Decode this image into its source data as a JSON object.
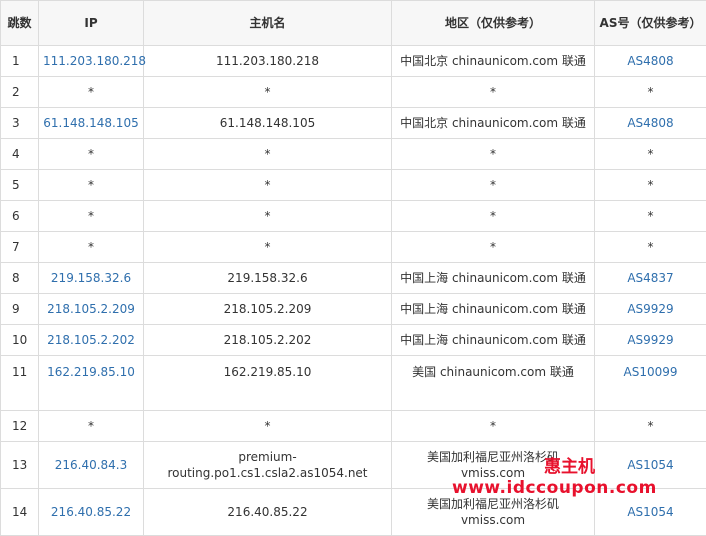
{
  "headers": {
    "hop": "跳数",
    "ip": "IP",
    "hostname": "主机名",
    "region": "地区（仅供参考）",
    "asn": "AS号（仅供参考）"
  },
  "rows": [
    {
      "hop": "1",
      "ip": "111.203.180.218",
      "host": "111.203.180.218",
      "region": "中国北京 chinaunicom.com 联通",
      "asn": "AS4808"
    },
    {
      "hop": "2",
      "ip": "*",
      "host": "*",
      "region": "*",
      "asn": "*"
    },
    {
      "hop": "3",
      "ip": "61.148.148.105",
      "host": "61.148.148.105",
      "region": "中国北京 chinaunicom.com 联通",
      "asn": "AS4808"
    },
    {
      "hop": "4",
      "ip": "*",
      "host": "*",
      "region": "*",
      "asn": "*"
    },
    {
      "hop": "5",
      "ip": "*",
      "host": "*",
      "region": "*",
      "asn": "*"
    },
    {
      "hop": "6",
      "ip": "*",
      "host": "*",
      "region": "*",
      "asn": "*"
    },
    {
      "hop": "7",
      "ip": "*",
      "host": "*",
      "region": "*",
      "asn": "*"
    },
    {
      "hop": "8",
      "ip": "219.158.32.6",
      "host": "219.158.32.6",
      "region": "中国上海 chinaunicom.com 联通",
      "asn": "AS4837"
    },
    {
      "hop": "9",
      "ip": "218.105.2.209",
      "host": "218.105.2.209",
      "region": "中国上海 chinaunicom.com 联通",
      "asn": "AS9929"
    },
    {
      "hop": "10",
      "ip": "218.105.2.202",
      "host": "218.105.2.202",
      "region": "中国上海 chinaunicom.com 联通",
      "asn": "AS9929"
    },
    {
      "hop": "11",
      "ip": "162.219.85.10",
      "host": "162.219.85.10",
      "region": "美国 chinaunicom.com 联通",
      "asn": "AS10099"
    },
    {
      "hop": "12",
      "ip": "*",
      "host": "*",
      "region": "*",
      "asn": "*"
    },
    {
      "hop": "13",
      "ip": "216.40.84.3",
      "host": "premium-routing.po1.cs1.csla2.as1054.net",
      "region": "美国加利福尼亚州洛杉矶 vmiss.com",
      "asn": "AS1054"
    },
    {
      "hop": "14",
      "ip": "216.40.85.22",
      "host": "216.40.85.22",
      "region": "美国加利福尼亚州洛杉矶 vmiss.com",
      "asn": "AS1054"
    }
  ],
  "watermark": {
    "brand": "惠主机",
    "url": "www.idccoupon.com",
    "color": "#e8112d"
  },
  "colors": {
    "link": "#2f6fad",
    "border": "#dcdcdc",
    "header_bg": "#f7f7f7"
  }
}
